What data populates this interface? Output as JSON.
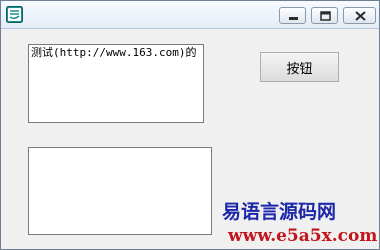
{
  "window": {
    "controls": {
      "minimize_icon": "minimize-icon",
      "maximize_icon": "maximize-icon",
      "close_icon": "close-icon"
    }
  },
  "edit_top": {
    "value": "测试(http://www.163.com)的"
  },
  "edit_bottom": {
    "value": ""
  },
  "button": {
    "label": "按钮"
  },
  "watermark": {
    "site_name": "易语言源码网",
    "url": "www.e5a5x.com"
  },
  "colors": {
    "watermark_name": "#1d28a8",
    "watermark_url": "#c4141b"
  }
}
